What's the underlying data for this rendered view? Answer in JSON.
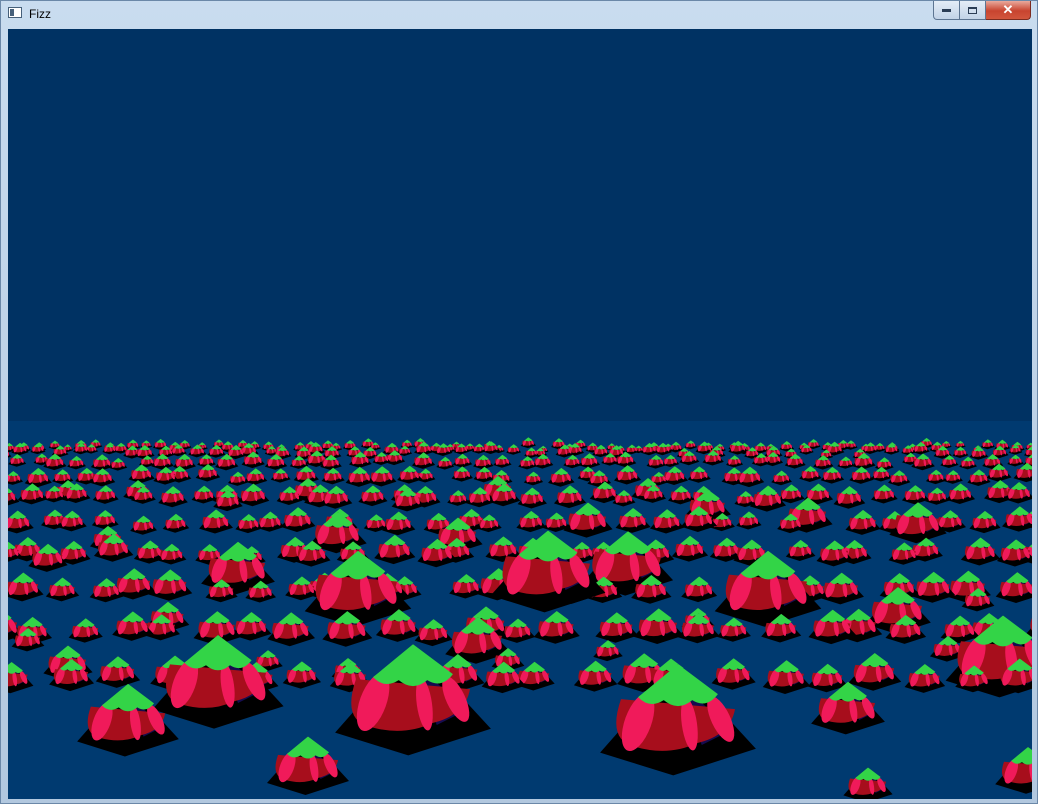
{
  "window": {
    "title": "Fizz",
    "minimize_glyph": "",
    "maximize_glyph": "",
    "close_glyph": "✕"
  },
  "scene": {
    "sky_color": "#003263",
    "ground_color": "#003a70",
    "palette": {
      "cap": "#33d447",
      "petal_dark": "#a70e1c",
      "petal_light": "#f01a5a",
      "shadow_blue": "#160c4f",
      "base": "#000000"
    }
  }
}
